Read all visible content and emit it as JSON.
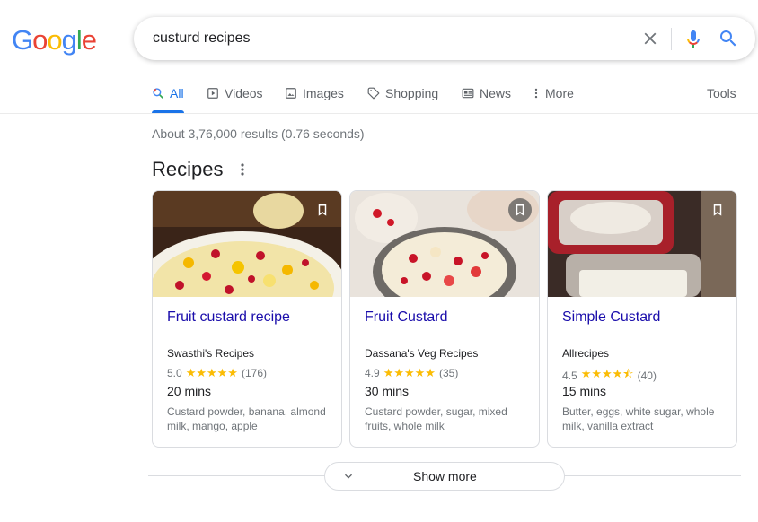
{
  "logo": {
    "letters": [
      "G",
      "o",
      "o",
      "g",
      "l",
      "e"
    ]
  },
  "search": {
    "query": "custurd recipes"
  },
  "tabs": [
    {
      "label": "All",
      "icon": "search-icon",
      "active": true
    },
    {
      "label": "Videos",
      "icon": "play-icon"
    },
    {
      "label": "Images",
      "icon": "image-icon"
    },
    {
      "label": "Shopping",
      "icon": "tag-icon"
    },
    {
      "label": "News",
      "icon": "newspaper-icon"
    },
    {
      "label": "More",
      "icon": "more-vert-icon"
    }
  ],
  "tools_label": "Tools",
  "result_stats": "About 3,76,000 results (0.76 seconds)",
  "section_title": "Recipes",
  "cards": [
    {
      "title": "Fruit custard recipe",
      "source": "Swasthi's Recipes",
      "rating": "5.0",
      "stars": "★★★★★",
      "reviews": "(176)",
      "time": "20 mins",
      "ingredients": "Custard powder, banana, almond milk, mango, apple"
    },
    {
      "title": "Fruit Custard",
      "source": "Dassana's Veg Recipes",
      "rating": "4.9",
      "stars": "★★★★★",
      "reviews": "(35)",
      "time": "30 mins",
      "ingredients": "Custard powder, sugar, mixed fruits, whole milk"
    },
    {
      "title": "Simple Custard",
      "source": "Allrecipes",
      "rating": "4.5",
      "stars": "★★★★⯪",
      "reviews": "(40)",
      "time": "15 mins",
      "ingredients": "Butter, eggs, white sugar, whole milk, vanilla extract"
    }
  ],
  "show_more_label": "Show more",
  "colors": {
    "link": "#1a0dab",
    "accent": "#1a73e8",
    "star": "#fbbc04"
  }
}
